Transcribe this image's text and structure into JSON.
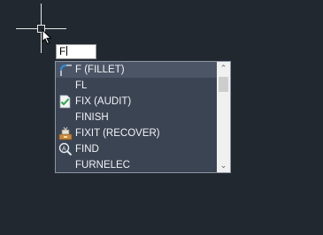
{
  "command_line": {
    "input_value": "F"
  },
  "suggestions": {
    "selected_index": 0,
    "items": [
      {
        "label": "F (FILLET)",
        "icon": "fillet-icon"
      },
      {
        "label": "FL",
        "icon": ""
      },
      {
        "label": "FIX (AUDIT)",
        "icon": "audit-icon"
      },
      {
        "label": "FINISH",
        "icon": ""
      },
      {
        "label": "FIXIT (RECOVER)",
        "icon": "recover-icon"
      },
      {
        "label": "FIND",
        "icon": "find-icon"
      },
      {
        "label": "FURNELEC",
        "icon": ""
      }
    ],
    "scroll_up_glyph": "⌃",
    "scroll_down_glyph": "⌄"
  },
  "colors": {
    "canvas": "#212830",
    "dropdown_bg": "#3b4453",
    "dropdown_selected": "#4b5566",
    "crosshair": "#e8e8e8"
  }
}
